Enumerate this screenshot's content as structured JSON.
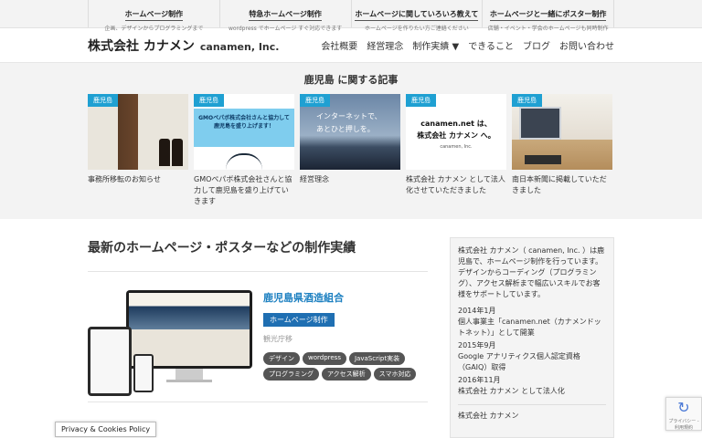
{
  "topbar": [
    {
      "title": "ホームページ制作",
      "sub": "企画、デザインからプログラミングまで"
    },
    {
      "title": "特急ホームページ制作",
      "sub": "wordpress でホームページ すぐ対応できます"
    },
    {
      "title": "ホームページに関していろいろ教えて",
      "sub": "ホームページを作りたい方ご連絡ください"
    },
    {
      "title": "ホームページと一緒にポスター制作",
      "sub": "店舗・イベント・学会のホームページも同時制作"
    }
  ],
  "header": {
    "logo_jp": "株式会社 カナメン",
    "logo_en": "canamen, Inc.",
    "nav": [
      "会社概要",
      "経営理念",
      "制作実績 ▼",
      "できること",
      "ブログ",
      "お問い合わせ"
    ]
  },
  "related": {
    "heading": "鹿児島 に関する記事",
    "cards": [
      {
        "tag": "鹿児島",
        "title": "事務所移転のお知らせ"
      },
      {
        "tag": "鹿児島",
        "title": "GMOペパボ株式会社さんと協力して鹿児島を盛り上げていきます",
        "img_text": "GMOペパボ株式会社さんと協力して 鹿児島を盛り上げます！"
      },
      {
        "tag": "鹿児島",
        "title": "経営理念",
        "img_text_1": "インターネットで、",
        "img_text_2": "あとひと押しを。"
      },
      {
        "tag": "鹿児島",
        "title": "株式会社 カナメン として法人化させていただきました",
        "img_text_1": "canamen.net は、",
        "img_text_2": "株式会社 カナメン へ。",
        "img_text_3": "canamen, Inc."
      },
      {
        "tag": "鹿児島",
        "title": "南日本新聞に掲載していただきました"
      }
    ]
  },
  "main": {
    "heading": "最新のホームページ・ポスターなどの制作実績",
    "work": {
      "title": "鹿児島県酒造組合",
      "category": "ホームページ制作",
      "location": "観光庁移",
      "tags": [
        "デザイン",
        "wordpress",
        "JavaScript実装",
        "プログラミング",
        "アクセス解析",
        "スマホ対応"
      ]
    }
  },
  "sidebar": {
    "intro": "株式会社 カナメン（ canamen, Inc. ）は鹿児島で、ホームページ制作を行っています。デザインからコーディング（プログラミング）、アクセス解析まで幅広いスキルでお客様をサポートしています。",
    "history": [
      {
        "date": "2014年1月",
        "text": "個人事業主「canamen.net（カナメンドットネット）」として開業"
      },
      {
        "date": "2015年9月",
        "text": "Google アナリティクス個人認定資格（GAIQ）取得"
      },
      {
        "date": "2016年11月",
        "text": "株式会社 カナメン として法人化"
      }
    ],
    "company": "株式会社 カナメン"
  },
  "overlays": {
    "privacy": "Privacy & Cookies Policy",
    "recaptcha": "プライバシー - 利用規約",
    "recaptcha_icon": "recaptcha-icon"
  }
}
